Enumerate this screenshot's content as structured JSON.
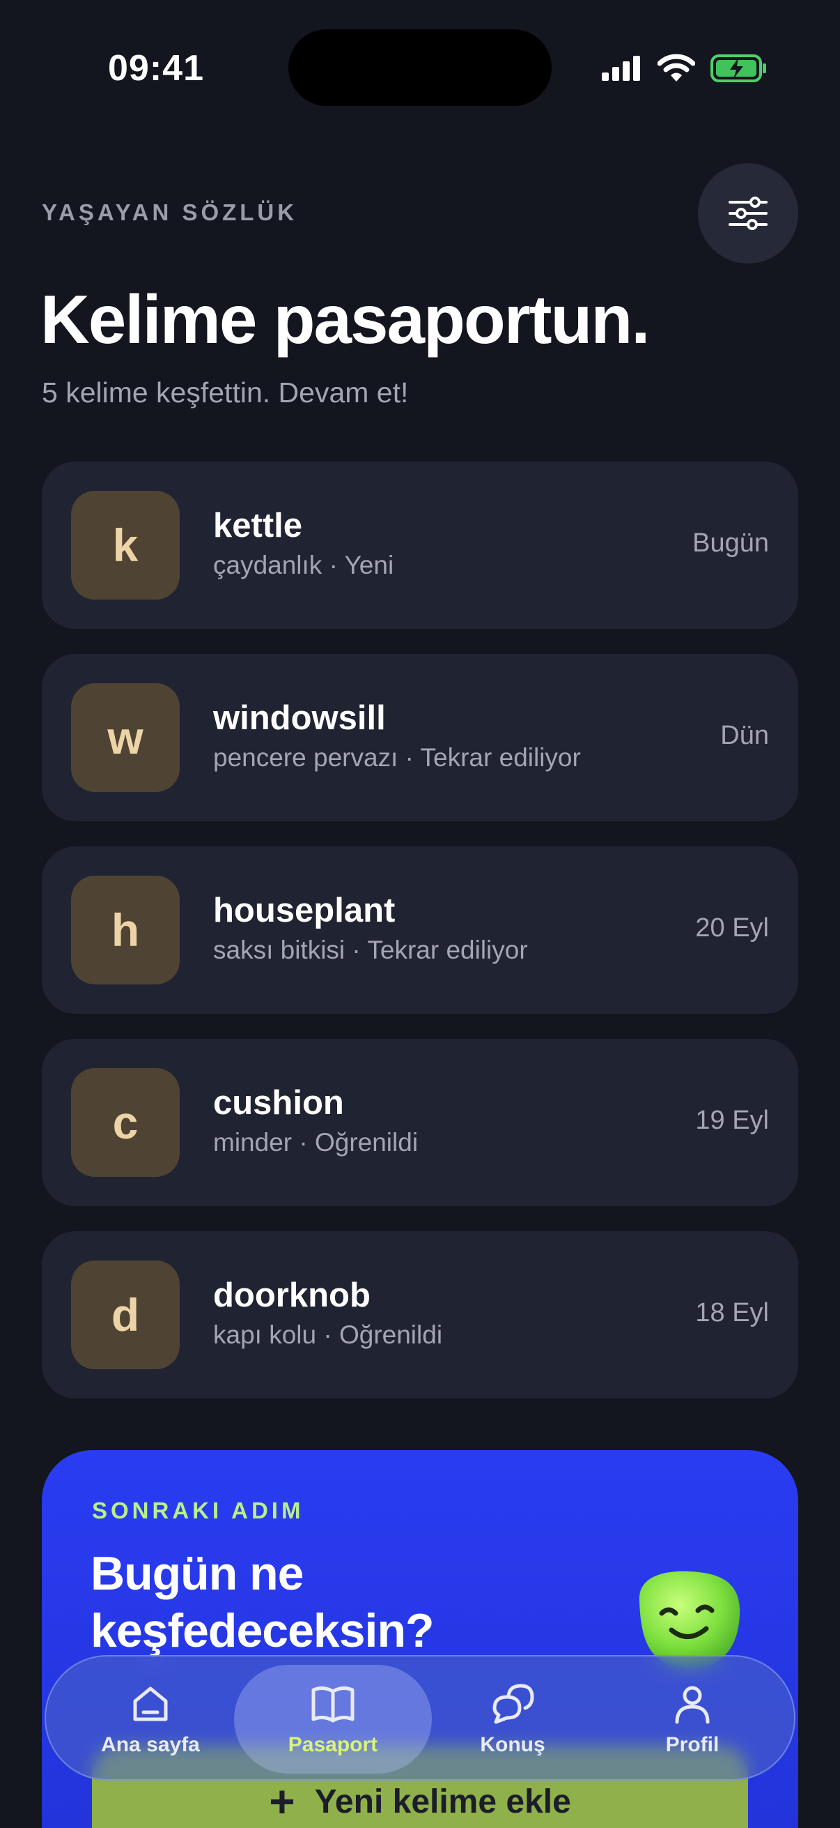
{
  "status_bar": {
    "time": "09:41"
  },
  "header": {
    "eyebrow": "YAŞAYAN SÖZLÜK",
    "title": "Kelime pasaportun.",
    "subtitle": "5 kelime keşfettin. Devam et!"
  },
  "words": [
    {
      "letter": "k",
      "word": "kettle",
      "meta": "çaydanlık · Yeni",
      "date": "Bugün"
    },
    {
      "letter": "w",
      "word": "windowsill",
      "meta": "pencere pervazı · Tekrar ediliyor",
      "date": "Dün"
    },
    {
      "letter": "h",
      "word": "houseplant",
      "meta": "saksı bitkisi · Tekrar ediliyor",
      "date": "20 Eyl"
    },
    {
      "letter": "c",
      "word": "cushion",
      "meta": "minder · Oğrenildi",
      "date": "19 Eyl"
    },
    {
      "letter": "d",
      "word": "doorknob",
      "meta": "kapı kolu · Oğrenildi",
      "date": "18 Eyl"
    }
  ],
  "next_step": {
    "eyebrow": "SONRAKI ADIM",
    "title": "Bugün ne keşfedeceksin?",
    "button_label": "Yeni kelime ekle"
  },
  "nav": {
    "items": [
      {
        "label": "Ana sayfa",
        "icon": "home-icon"
      },
      {
        "label": "Pasaport",
        "icon": "book-icon"
      },
      {
        "label": "Konuş",
        "icon": "chat-icon"
      },
      {
        "label": "Profil",
        "icon": "user-icon"
      }
    ],
    "active": "Pasaport"
  },
  "colors": {
    "background": "#13151f",
    "card": "#202331",
    "tile": "#4f4333",
    "accent_blue": "#2a3cf2",
    "accent_green": "#b9f08a",
    "button_green": "#8fb04a"
  }
}
